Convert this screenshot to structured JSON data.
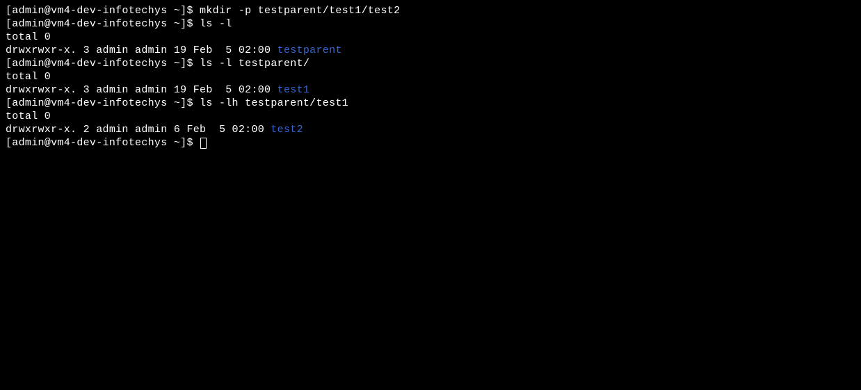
{
  "prompt": "[admin@vm4-dev-infotechys ~]$ ",
  "lines": {
    "cmd1": "mkdir -p testparent/test1/test2",
    "cmd2": "ls -l",
    "total0_a": "total 0",
    "entry1_prefix": "drwxrwxr-x. 3 admin admin 19 Feb  5 02:00 ",
    "entry1_dir": "testparent",
    "cmd3": "ls -l testparent/",
    "total0_b": "total 0",
    "entry2_prefix": "drwxrwxr-x. 3 admin admin 19 Feb  5 02:00 ",
    "entry2_dir": "test1",
    "cmd4": "ls -lh testparent/test1",
    "total0_c": "total 0",
    "entry3_prefix": "drwxrwxr-x. 2 admin admin 6 Feb  5 02:00 ",
    "entry3_dir": "test2"
  }
}
